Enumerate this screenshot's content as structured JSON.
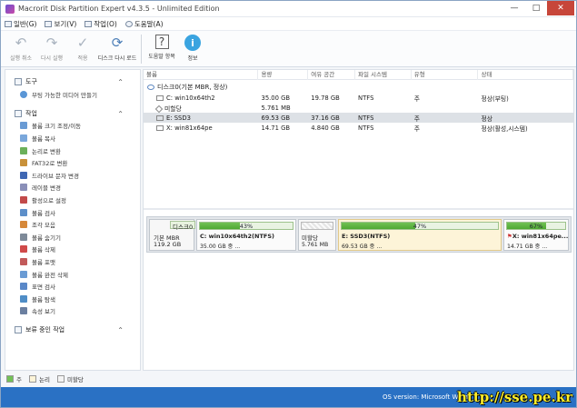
{
  "window": {
    "title": "Macrorit Disk Partition Expert v4.3.5 - Unlimited Edition"
  },
  "menu": [
    "일반(G)",
    "보기(V)",
    "작업(O)",
    "도움말(A)"
  ],
  "toolbar": {
    "undo": "실행 취소",
    "redo": "다시 실행",
    "commit": "적용",
    "reload": "디스크 다시 로드",
    "help": "도움말 항목",
    "info": "정보"
  },
  "sidebar": {
    "tools_title": "도구",
    "tools_items": [
      "부팅 가능한 미디어 만들기"
    ],
    "ops_title": "작업",
    "ops_items": [
      "볼륨 크기 조정/이동",
      "볼륨 복사",
      "논리로 변환",
      "FAT32로 변환",
      "드라이브 문자 변경",
      "레이블 변경",
      "활성으로 설정",
      "볼륨 검사",
      "조각 모음",
      "볼륨 숨기기",
      "볼륨 삭제",
      "볼륨 포맷",
      "볼륨 완전 삭제",
      "표면 검사",
      "볼륨 탐색",
      "속성 보기"
    ],
    "pending_title": "보류 중인 작업"
  },
  "table": {
    "headers": [
      "볼륨",
      "용량",
      "여유 공간",
      "파일 시스템",
      "유형",
      "상태"
    ],
    "disk_label": "디스크0(기본 MBR, 정상)",
    "rows": [
      {
        "volume": "C: win10x64th2",
        "capacity": "35.00 GB",
        "free": "19.78 GB",
        "fs": "NTFS",
        "type": "주",
        "status": "정상(부팅)"
      },
      {
        "volume": "미할당",
        "capacity": "5.761 MB",
        "free": "",
        "fs": "",
        "type": "",
        "status": ""
      },
      {
        "volume": "E: SSD3",
        "capacity": "69.53 GB",
        "free": "37.16 GB",
        "fs": "NTFS",
        "type": "주",
        "status": "정상"
      },
      {
        "volume": "X: win81x64pe",
        "capacity": "14.71 GB",
        "free": "4.840 GB",
        "fs": "NTFS",
        "type": "주",
        "status": "정상(활성,시스템)"
      }
    ]
  },
  "splitter_dots": "....",
  "diskmap": {
    "disk_name": "디스크0",
    "disk_type": "기본 MBR",
    "disk_size": "119.2 GB",
    "partitions": [
      {
        "pct": "43%",
        "fill": 0.43,
        "name": "C: win10x64th2(NTFS)",
        "size": "35.00 GB 중 ..."
      },
      {
        "pct": "",
        "fill": 0,
        "name": "미할당",
        "size": "5.761 MB"
      },
      {
        "pct": "47%",
        "fill": 0.47,
        "name": "E: SSD3(NTFS)",
        "size": "69.53 GB 중 ..."
      },
      {
        "pct": "67%",
        "fill": 0.67,
        "name": "X: win81x64pe...",
        "size": "14.71 GB 중 ..."
      }
    ]
  },
  "legend": [
    "주",
    "논리",
    "미할당"
  ],
  "colors": {
    "primary": "#72c156",
    "logical": "#fdf4d8",
    "unalloc": "#f4f4f4",
    "status_bar": "#2a71c4"
  },
  "statusbar": {
    "os": "OS version: Microsoft Wind"
  },
  "watermark": "http://sse.pe.kr"
}
